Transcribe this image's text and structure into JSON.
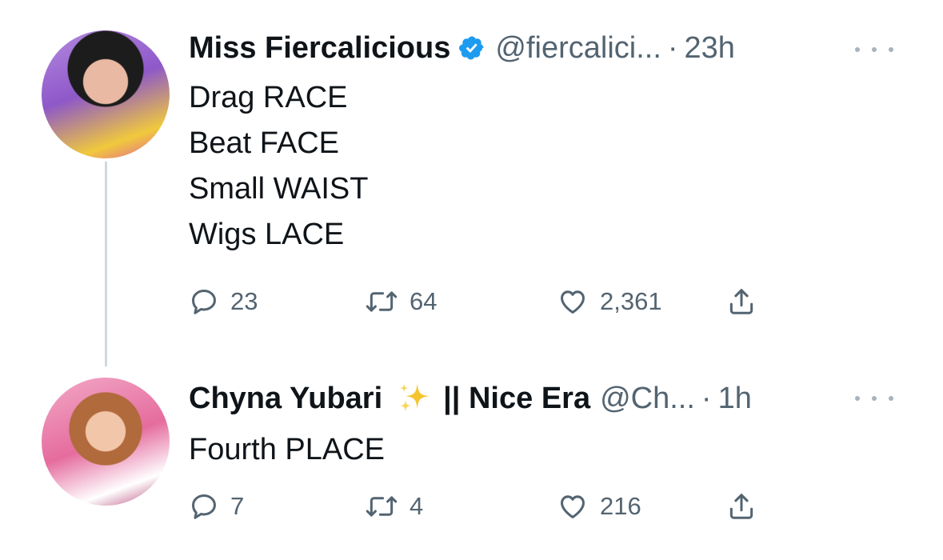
{
  "tweets": [
    {
      "display_name": "Miss Fiercalicious",
      "verified": true,
      "handle": "@fiercalici...",
      "separator": "·",
      "time": "23h",
      "lines": [
        "Drag RACE",
        "Beat FACE",
        "Small WAIST",
        "Wigs LACE"
      ],
      "replies": "23",
      "retweets": "64",
      "likes": "2,361"
    },
    {
      "display_name": "Chyna Yubari",
      "name_suffix": "|| Nice Era",
      "handle": "@Ch...",
      "separator": "·",
      "time": "1h",
      "lines": [
        "Fourth PLACE"
      ],
      "replies": "7",
      "retweets": "4",
      "likes": "216"
    }
  ],
  "icons": {
    "reply": "speech-bubble-icon",
    "retweet": "retweet-arrows-icon",
    "like": "heart-icon",
    "share": "share-upload-icon",
    "more": "more-dots-icon",
    "verified": "verified-badge-icon",
    "sparkle": "sparkles-emoji-icon"
  },
  "colors": {
    "text": "#0f1419",
    "muted": "#536471",
    "verified_blue": "#1d9bf0",
    "thread_line": "#cfd9de"
  }
}
